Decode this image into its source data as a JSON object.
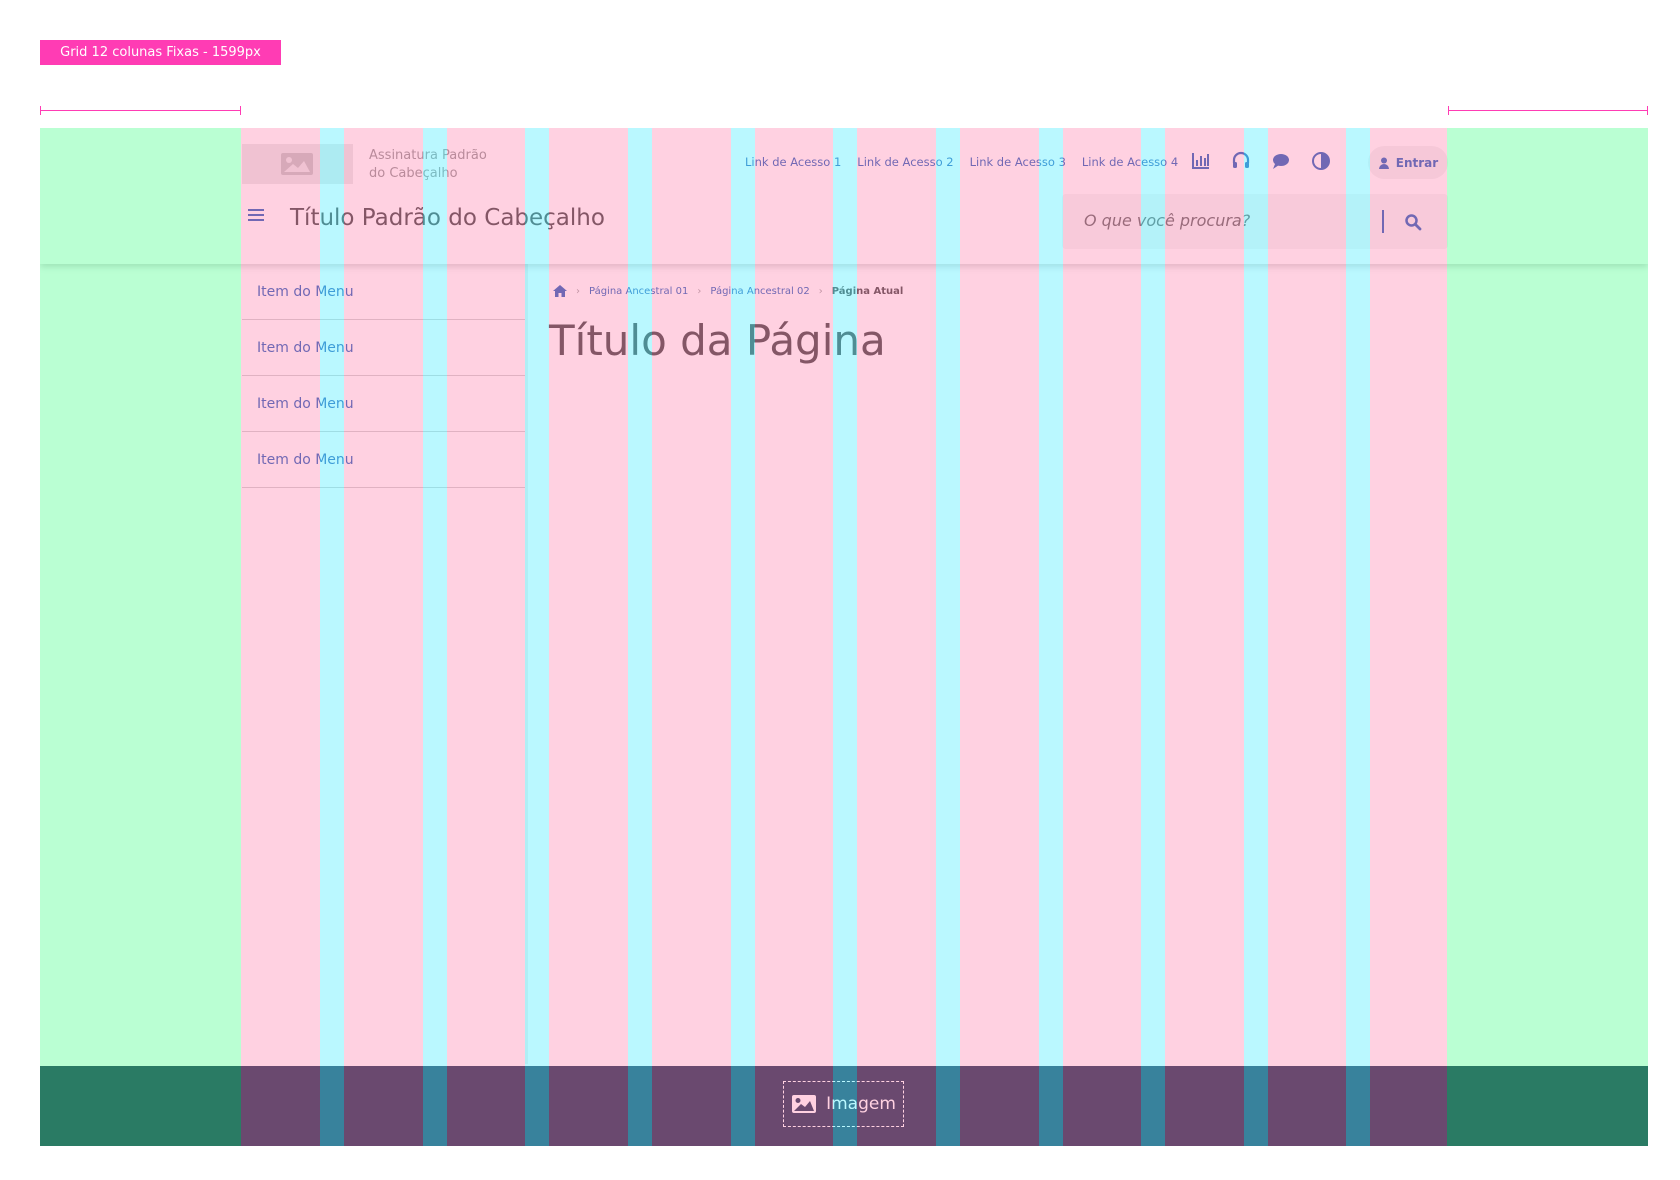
{
  "grid_label": "Grid 12 colunas Fixas - 1599px",
  "header": {
    "signature_line1": "Assinatura Padrão",
    "signature_line2": "do Cabeçalho",
    "access_links": [
      "Link de Acesso 1",
      "Link de Acesso 2",
      "Link de Acesso 3",
      "Link de Acesso 4"
    ],
    "icons": [
      "chart-icon",
      "headset-icon",
      "chat-icon",
      "contrast-icon"
    ],
    "login_label": "Entrar",
    "title": "Título Padrão do Cabeçalho",
    "search_placeholder": "O que você procura?"
  },
  "menu": {
    "items": [
      "Item do Menu",
      "Item do Menu",
      "Item do Menu",
      "Item do Menu"
    ]
  },
  "breadcrumb": {
    "items": [
      "Página Ancestral 01",
      "Página Ancestral 02"
    ],
    "current": "Página Atual"
  },
  "page": {
    "title": "Título da Página"
  },
  "footer": {
    "image_label": "Imagem"
  },
  "colors": {
    "primary": "#1351b4",
    "footer_bg": "#071d41",
    "grid_tag": "#ff3cb4",
    "margin_overlay": "#5aff96",
    "column_overlay": "#ff8cb4",
    "gutter_overlay": "#6ef0ff"
  }
}
